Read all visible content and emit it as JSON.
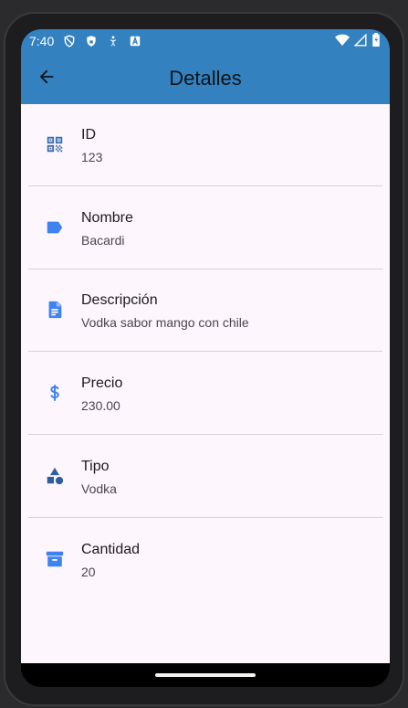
{
  "status_bar": {
    "time": "7:40",
    "left_icons": [
      "shield-outline-icon",
      "shield-filled-icon",
      "accessibility-icon",
      "a-badge-icon"
    ],
    "right_icons": [
      "wifi-icon",
      "signal-icon",
      "battery-icon"
    ]
  },
  "app_bar": {
    "title": "Detalles",
    "back_icon": "arrow-back-icon",
    "background": "#3481c0"
  },
  "details": [
    {
      "label": "ID",
      "value": "123",
      "icon": "qr-code-icon"
    },
    {
      "label": "Nombre",
      "value": "Bacardi",
      "icon": "label-tag-icon"
    },
    {
      "label": "Descripción",
      "value": "Vodka sabor mango con chile",
      "icon": "description-icon"
    },
    {
      "label": "Precio",
      "value": "230.00",
      "icon": "dollar-icon"
    },
    {
      "label": "Tipo",
      "value": "Vodka",
      "icon": "category-shapes-icon"
    },
    {
      "label": "Cantidad",
      "value": "20",
      "icon": "inventory-box-icon"
    }
  ],
  "colors": {
    "primary": "#3481c0",
    "icon_blue": "#3f83f0",
    "icon_dark": "#2e5e9e",
    "surface": "#fdf6fd"
  }
}
